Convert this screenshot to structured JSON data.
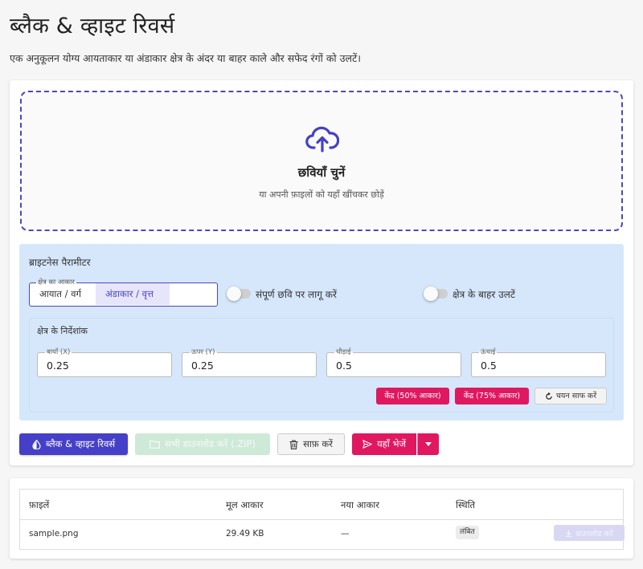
{
  "page": {
    "title": "ब्लैक & व्हाइट रिवर्स",
    "subtitle": "एक अनुकूलन योग्य आयताकार या अंडाकार क्षेत्र के अंदर या बाहर काले और सफेद रंगों को उलटें।"
  },
  "dropzone": {
    "icon": "cloud-upload-icon",
    "title": "छवियाँ चुनें",
    "subtitle": "या अपनी फ़ाइलों को यहाँ खींचकर छोड़ें"
  },
  "params": {
    "title": "ब्राइटनेस पैरामीटर",
    "shape": {
      "legend": "क्षेत्र का आकार",
      "options": [
        "आयात / वर्ग",
        "अंडाकार / वृत्त"
      ],
      "selected": "अंडाकार / वृत्त"
    },
    "toggles": [
      {
        "label": "संपूर्ण छवि पर लागू करें",
        "on": false
      },
      {
        "label": "क्षेत्र के बाहर उलटें",
        "on": false
      }
    ],
    "coords": {
      "title": "क्षेत्र के निर्देशांक",
      "fields": [
        {
          "label": "बायाँ (X)",
          "value": "0.25"
        },
        {
          "label": "ऊपर (Y)",
          "value": "0.25"
        },
        {
          "label": "चौड़ाई",
          "value": "0.5"
        },
        {
          "label": "ऊंचाई",
          "value": "0.5"
        }
      ],
      "chips": {
        "center50": "केंद्र (50% आकार)",
        "center75": "केंद्र (75% आकार)",
        "reset": "चयन साफ करें"
      }
    }
  },
  "actions": {
    "process": "ब्लैक & व्हाइट रिवर्स",
    "download_all": "सभी डाउनलोड करें (.ZIP)",
    "clear": "साफ़ करें",
    "send": "यहाँ भेजें"
  },
  "files": {
    "headers": [
      "फ़ाइलें",
      "मूल आकार",
      "नया आकार",
      "स्थिति"
    ],
    "rows": [
      {
        "name": "sample.png",
        "original_size": "29.49 KB",
        "new_size": "—",
        "status": "लंबित",
        "download": "डाउनलोड करें"
      }
    ]
  },
  "colors": {
    "primary": "#4540c7",
    "accent": "#e0185f",
    "panel": "#d6e7fb"
  }
}
